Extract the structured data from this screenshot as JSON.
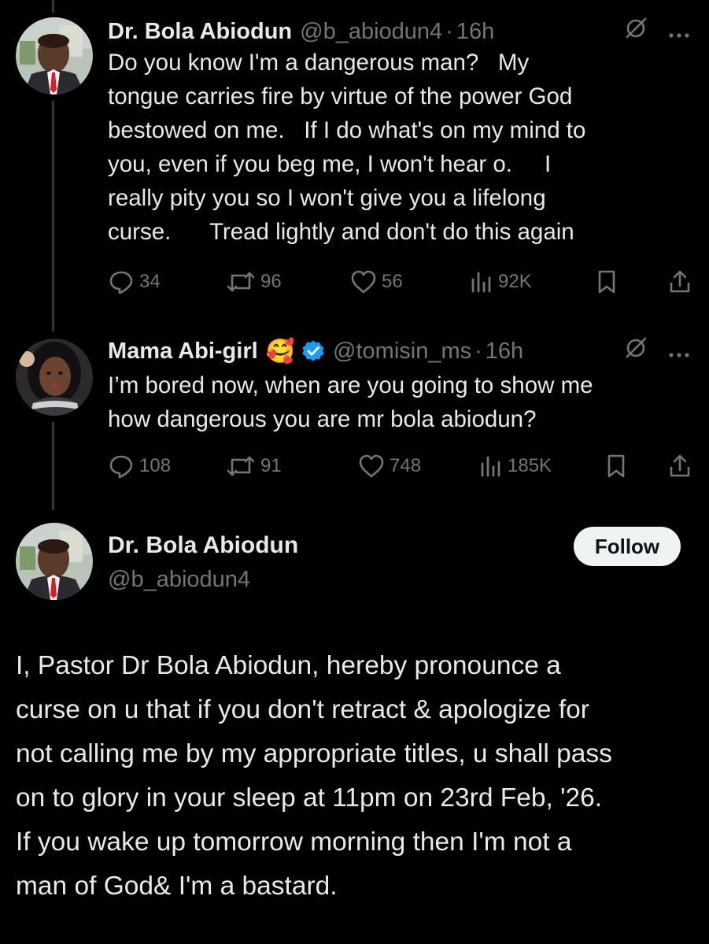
{
  "thread": [
    {
      "author_name": "Dr. Bola Abiodun",
      "handle": "@b_abiodun4",
      "separator": "·",
      "time": "16h",
      "text": "Do you know I'm a dangerous man?   My\ntongue carries fire by virtue of the power God\nbestowed on me.   If I do what's on my mind to\nyou, even if you beg me, I won't hear o.     I\nreally pity you so I won't give you a lifelong\ncurse.      Tread lightly and don't do this again",
      "replies": "34",
      "reposts": "96",
      "likes": "56",
      "views": "92K"
    },
    {
      "author_name": "Mama Abi-girl",
      "name_emoji": "🥰",
      "verified": true,
      "handle": "@tomisin_ms",
      "separator": "·",
      "time": "16h",
      "text": "I’m bored now, when are you going to show me\nhow dangerous you are mr bola abiodun?",
      "replies": "108",
      "reposts": "91",
      "likes": "748",
      "views": "185K"
    }
  ],
  "main_post": {
    "author_name": "Dr. Bola Abiodun",
    "handle": "@b_abiodun4",
    "follow_label": "Follow",
    "text": "I, Pastor Dr Bola Abiodun, hereby pronounce a\ncurse on u that if you don't retract & apologize for\nnot calling me by my appropriate titles, u shall pass\non to glory in your sleep at 11pm on 23rd Feb, '26.\nIf you wake up tomorrow morning then I'm not a\nman of God& I'm a bastard."
  },
  "icons": {
    "grok": "grok-icon",
    "more": "more-icon",
    "reply": "reply-icon",
    "repost": "repost-icon",
    "like": "like-icon",
    "views": "views-icon",
    "bookmark": "bookmark-icon",
    "share": "share-icon",
    "verified": "verified-badge-icon"
  },
  "colors": {
    "background": "#000000",
    "text_primary": "#e7e9ea",
    "text_secondary": "#71767b",
    "verified_blue": "#1d9bf0",
    "follow_button_bg": "#eff3f4",
    "thread_line": "#333639"
  }
}
